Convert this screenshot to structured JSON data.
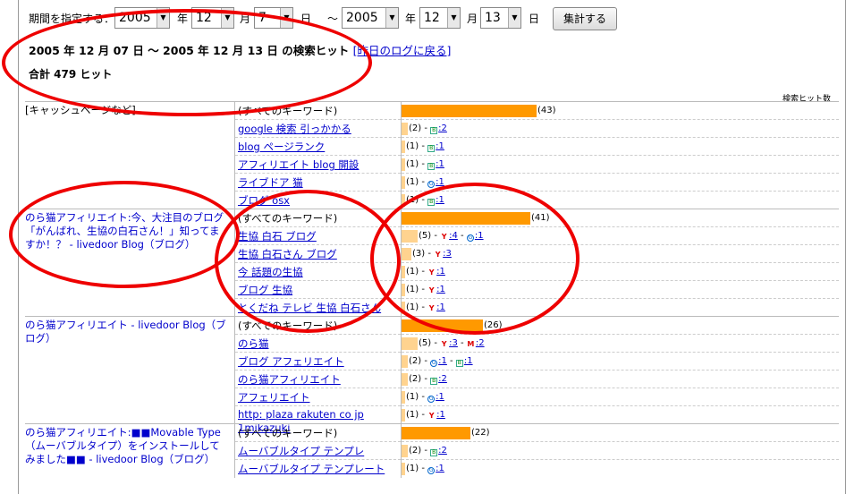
{
  "period": {
    "label": "期間を指定する：",
    "from_year": "2005",
    "year1": "年",
    "from_month": "12",
    "month1": "月",
    "from_day": "7",
    "day1": "日",
    "tilde": "〜",
    "to_year": "2005",
    "year2": "年",
    "to_month": "12",
    "month2": "月",
    "to_day": "13",
    "day2": "日",
    "submit_label": "集計する"
  },
  "heading": {
    "text": "2005 年 12 月 07 日 〜 2005 年 12 月 13 日 の検索ヒット",
    "back_link": "[昨日のログに戻る]"
  },
  "total": "合計 479 ヒット",
  "hits_header": "検索ヒット数",
  "groups": [
    {
      "page": "[キャッシュページなど]",
      "rows": [
        {
          "keyword": "(すべてのキーワード)",
          "count_text": "(43)",
          "engines": []
        },
        {
          "keyword": "google 検索 引っかかる",
          "count_text": "(2) - ",
          "engines": [
            {
              "icon": "b",
              "text": ":2"
            }
          ]
        },
        {
          "keyword": "blog ページランク",
          "count_text": "(1) - ",
          "engines": [
            {
              "icon": "b",
              "text": ":1"
            }
          ]
        },
        {
          "keyword": "アフィリエイト blog 開設",
          "count_text": "(1) - ",
          "engines": [
            {
              "icon": "b",
              "text": ":1"
            }
          ]
        },
        {
          "keyword": "ライブドア 猫",
          "count_text": "(1) - ",
          "engines": [
            {
              "icon": "g",
              "text": ":1"
            }
          ]
        },
        {
          "keyword": "ブログ osx",
          "count_text": "(1) - ",
          "engines": [
            {
              "icon": "b",
              "text": ":1"
            }
          ]
        }
      ]
    },
    {
      "page": "のら猫アフィリエイト:今、大注目のブログ「がんばれ、生協の白石さん！」知ってますか！？ - livedoor Blog（ブログ）",
      "rows": [
        {
          "keyword": "(すべてのキーワード)",
          "count_text": "(41)",
          "engines": []
        },
        {
          "keyword": "生協 白石 ブログ",
          "count_text": "(5) - ",
          "engines": [
            {
              "icon": "y",
              "text": ":4"
            },
            {
              "icon": "g",
              "text": ":1"
            }
          ]
        },
        {
          "keyword": "生協 白石さん ブログ",
          "count_text": "(3) - ",
          "engines": [
            {
              "icon": "y",
              "text": ":3"
            }
          ]
        },
        {
          "keyword": "今 話題の生協",
          "count_text": "(1) - ",
          "engines": [
            {
              "icon": "y",
              "text": ":1"
            }
          ]
        },
        {
          "keyword": "ブログ 生協",
          "count_text": "(1) - ",
          "engines": [
            {
              "icon": "y",
              "text": ":1"
            }
          ]
        },
        {
          "keyword": "とくだね テレビ 生協 白石さん",
          "count_text": "(1) - ",
          "engines": [
            {
              "icon": "y",
              "text": ":1"
            }
          ]
        }
      ]
    },
    {
      "page": "のら猫アフィリエイト - livedoor Blog（ブログ）",
      "rows": [
        {
          "keyword": "(すべてのキーワード)",
          "count_text": "(26)",
          "engines": []
        },
        {
          "keyword": "のら猫",
          "count_text": "(5) - ",
          "engines": [
            {
              "icon": "y",
              "text": ":3"
            },
            {
              "icon": "m",
              "text": ":2"
            }
          ]
        },
        {
          "keyword": "ブログ アフェリエイト",
          "count_text": "(2) - ",
          "engines": [
            {
              "icon": "g",
              "text": ":1"
            },
            {
              "icon": "b",
              "text": ":1"
            }
          ]
        },
        {
          "keyword": "のら猫アフィリエイト",
          "count_text": "(2) - ",
          "engines": [
            {
              "icon": "b",
              "text": ":2"
            }
          ]
        },
        {
          "keyword": "アフェリエイト",
          "count_text": "(1) - ",
          "engines": [
            {
              "icon": "g",
              "text": ":1"
            }
          ]
        },
        {
          "keyword": "http: plaza rakuten co jp 1mikazuki",
          "count_text": "(1) - ",
          "engines": [
            {
              "icon": "y",
              "text": ":1"
            }
          ]
        }
      ]
    },
    {
      "page": "のら猫アフィリエイト:■■Movable Type（ムーバブルタイプ）をインストールしてみました■■ - livedoor Blog（ブログ）",
      "rows": [
        {
          "keyword": "(すべてのキーワード)",
          "count_text": "(22)",
          "engines": []
        },
        {
          "keyword": "ムーバブルタイプ テンプレ",
          "count_text": "(2) - ",
          "engines": [
            {
              "icon": "b",
              "text": ":2"
            }
          ]
        },
        {
          "keyword": "ムーバブルタイプ テンプレート",
          "count_text": "(1) - ",
          "engines": [
            {
              "icon": "g",
              "text": ":1"
            }
          ]
        }
      ]
    }
  ]
}
